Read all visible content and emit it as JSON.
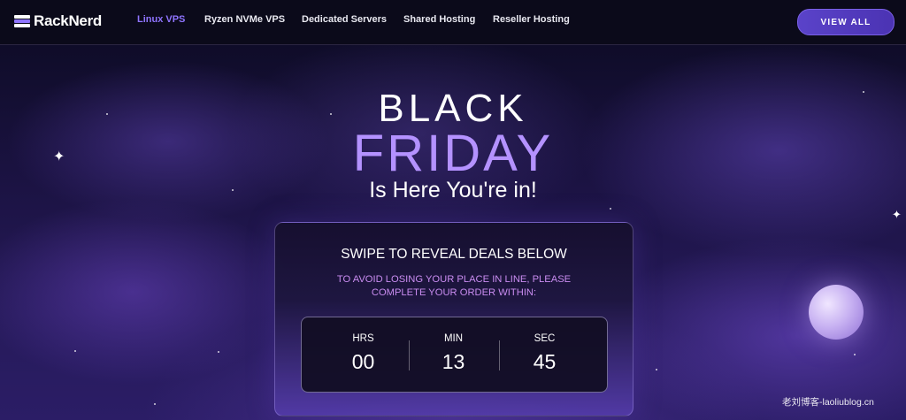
{
  "brand": {
    "name": "RackNerd"
  },
  "nav": {
    "links": [
      "Linux VPS",
      "Ryzen NVMe VPS",
      "Dedicated Servers",
      "Shared Hosting",
      "Reseller Hosting"
    ],
    "active_index": 0,
    "cta_label": "VIEW ALL"
  },
  "hero": {
    "line1": "BLACK",
    "line2": "FRIDAY",
    "line3": "Is Here You're in!"
  },
  "countdown": {
    "title": "SWIPE TO REVEAL DEALS BELOW",
    "note": "TO AVOID LOSING YOUR PLACE IN LINE, PLEASE COMPLETE YOUR ORDER WITHIN:",
    "units": [
      {
        "label": "HRS",
        "value": "00"
      },
      {
        "label": "MIN",
        "value": "13"
      },
      {
        "label": "SEC",
        "value": "45"
      }
    ]
  },
  "watermark": "老刘博客-laoliublog.cn",
  "colors": {
    "accent": "#8f74ff",
    "friday": "#b492ff",
    "note": "#c98cf0"
  }
}
